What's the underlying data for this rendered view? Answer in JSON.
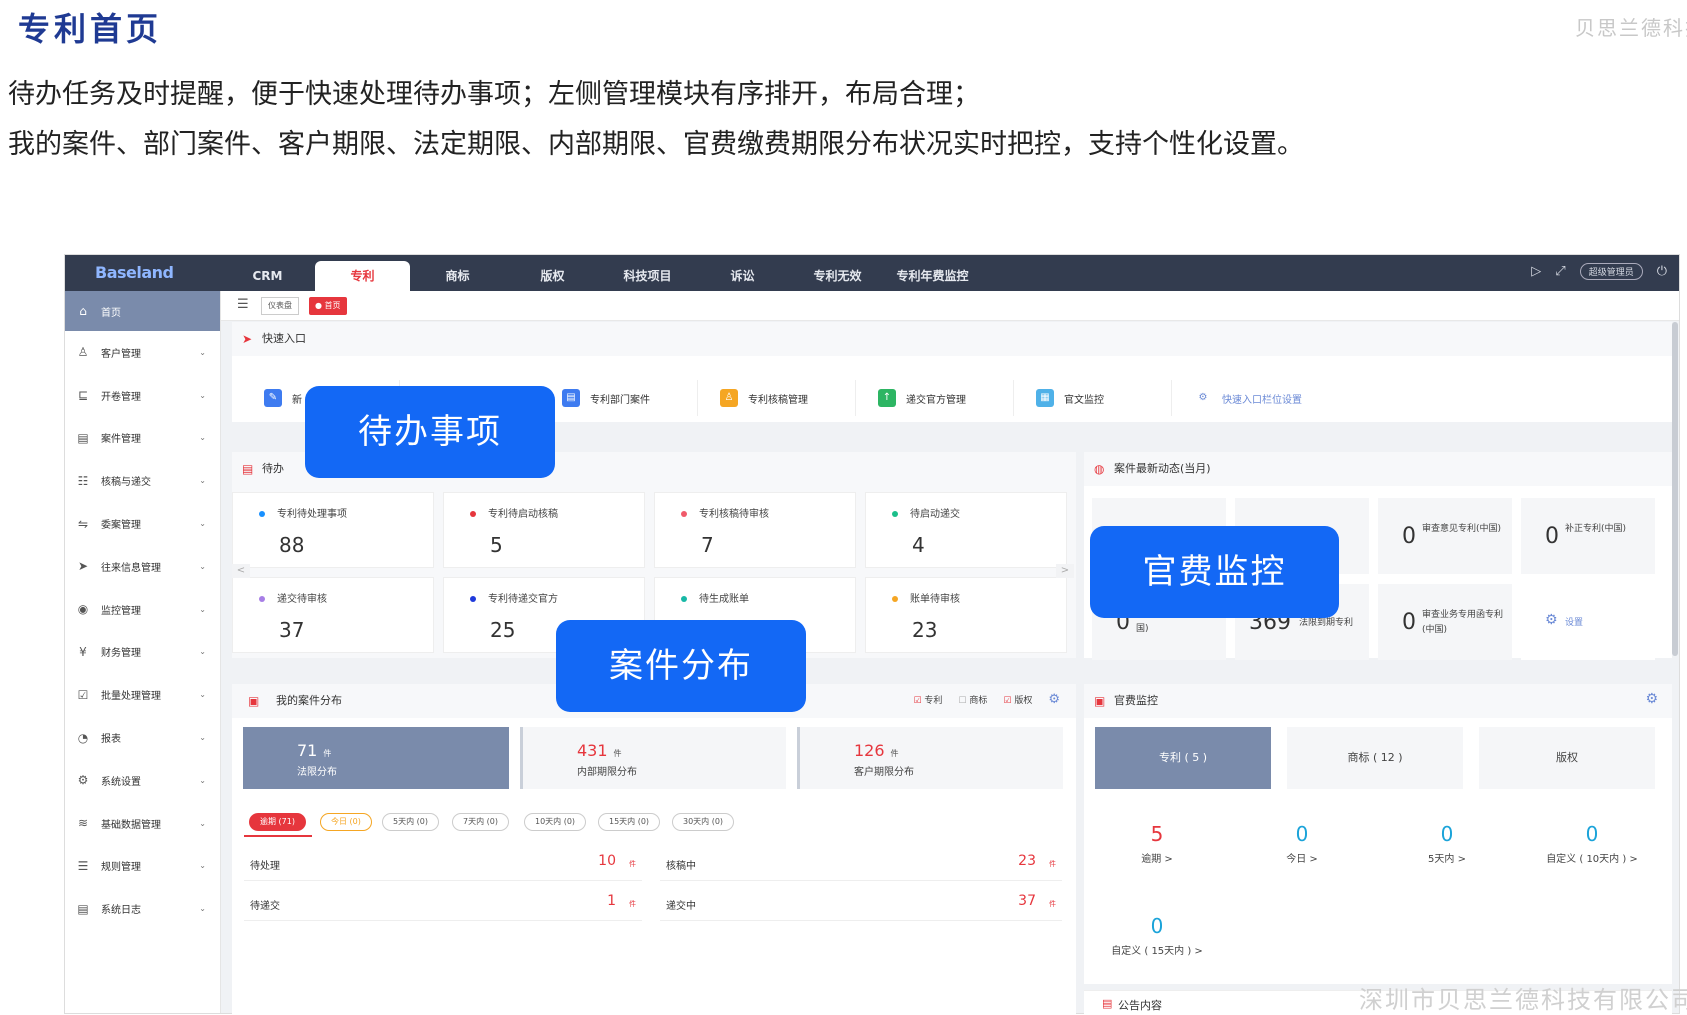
{
  "slide": {
    "title": "专利首页",
    "watermark_top": "贝思兰德科技",
    "desc_line1": "待办任务及时提醒，便于快速处理待办事项；左侧管理模块有序排开，布局合理；",
    "desc_line2": "我的案件、部门案件、客户期限、法定期限、内部期限、官费缴费期限分布状况实时把控，支持个性化设置。",
    "watermark_bottom": "深圳市贝思兰德科技有限公司"
  },
  "callouts": {
    "todo": "待办事项",
    "fee": "官费监控",
    "dist": "案件分布"
  },
  "app": {
    "logo": "Baseland",
    "topnav": [
      "CRM",
      "专利",
      "商标",
      "版权",
      "科技项目",
      "诉讼",
      "专利无效",
      "专利年费监控"
    ],
    "admin": "超级管理员",
    "breadcrumb": {
      "tag1": "仪表盘",
      "tag2": "首页"
    },
    "sidebar": [
      {
        "label": "首页",
        "icon": "home-icon"
      },
      {
        "label": "客户管理",
        "icon": "user-icon"
      },
      {
        "label": "开卷管理",
        "icon": "folder-icon"
      },
      {
        "label": "案件管理",
        "icon": "case-icon"
      },
      {
        "label": "核稿与递交",
        "icon": "review-icon"
      },
      {
        "label": "委案管理",
        "icon": "delegate-icon"
      },
      {
        "label": "往来信息管理",
        "icon": "send-icon"
      },
      {
        "label": "监控管理",
        "icon": "monitor-icon"
      },
      {
        "label": "财务管理",
        "icon": "finance-icon"
      },
      {
        "label": "批量处理管理",
        "icon": "batch-icon"
      },
      {
        "label": "报表",
        "icon": "report-icon"
      },
      {
        "label": "系统设置",
        "icon": "gear-icon"
      },
      {
        "label": "基础数据管理",
        "icon": "layers-icon"
      },
      {
        "label": "规则管理",
        "icon": "rules-icon"
      },
      {
        "label": "系统日志",
        "icon": "log-icon"
      }
    ],
    "quick": {
      "title": "快速入口",
      "items": [
        "新",
        "专利部门案件",
        "专利核稿管理",
        "递交官方管理",
        "官文监控",
        "快速入口栏位设置"
      ]
    },
    "todo": {
      "title": "待办",
      "cards": [
        {
          "label": "专利待处理事项",
          "value": "88",
          "color": "#1890ff"
        },
        {
          "label": "专利待启动核稿",
          "value": "5",
          "color": "#e6363d"
        },
        {
          "label": "专利核稿待审核",
          "value": "7",
          "color": "#f05a6a"
        },
        {
          "label": "待启动递交",
          "value": "4",
          "color": "#1bbf8a"
        },
        {
          "label": "递交待审核",
          "value": "37",
          "color": "#a77ee6"
        },
        {
          "label": "专利待递交官方",
          "value": "25",
          "color": "#1f3adb"
        },
        {
          "label": "待生成账单",
          "value": "",
          "color": "#17b8a6"
        },
        {
          "label": "账单待审核",
          "value": "23",
          "color": "#f5a623"
        }
      ],
      "prev": "<",
      "next": ">"
    },
    "dynamic": {
      "title": "案件最新动态(当月)",
      "cards": [
        {
          "num": "",
          "text": ""
        },
        {
          "num": "",
          "text": ""
        },
        {
          "num": "0",
          "text": "审查意见专利(中国)"
        },
        {
          "num": "0",
          "text": "补正专利(中国)"
        },
        {
          "num": "0",
          "text": "国)"
        },
        {
          "num": "369",
          "text": "法限到期专利"
        },
        {
          "num": "0",
          "text": "审查业务专用函专利(中国)"
        },
        {
          "num": "",
          "text": "设置"
        }
      ]
    },
    "dist": {
      "title": "我的案件分布",
      "filters": [
        "专利",
        "商标",
        "版权"
      ],
      "boxes": [
        {
          "num": "71",
          "unit": "件",
          "label": "法限分布"
        },
        {
          "num": "431",
          "unit": "件",
          "label": "内部期限分布"
        },
        {
          "num": "126",
          "unit": "件",
          "label": "客户期限分布"
        }
      ],
      "chips": [
        "逾期 (71)",
        "今日 (0)",
        "5天内 (0)",
        "7天内 (0)",
        "10天内 (0)",
        "15天内 (0)",
        "30天内 (0)"
      ],
      "rows": [
        {
          "l_label": "待处理",
          "l_val": "10",
          "r_label": "核稿中",
          "r_val": "23"
        },
        {
          "l_label": "待递交",
          "l_val": "1",
          "r_label": "递交中",
          "r_val": "37"
        }
      ],
      "unit": "件"
    },
    "fee": {
      "title": "官费监控",
      "tabs": [
        "专利 ( 5 )",
        "商标 ( 12 )",
        "版权"
      ],
      "stats": [
        {
          "num": "5",
          "label": "逾期 >",
          "color": "#e6363d"
        },
        {
          "num": "0",
          "label": "今日 >",
          "color": "#1aa3d9"
        },
        {
          "num": "0",
          "label": "5天内 >",
          "color": "#1aa3d9"
        },
        {
          "num": "0",
          "label": "自定义 ( 10天内 ) >",
          "color": "#1aa3d9"
        },
        {
          "num": "0",
          "label": "自定义 ( 15天内 ) >",
          "color": "#1aa3d9"
        }
      ]
    },
    "notice": {
      "title": "公告内容"
    }
  }
}
